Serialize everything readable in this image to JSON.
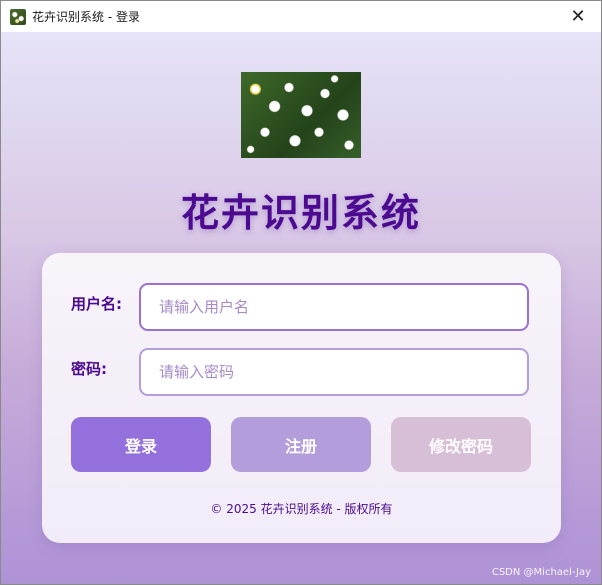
{
  "window": {
    "title": "花卉识别系统 - 登录",
    "close_glyph": "✕",
    "icon": "flower-photo-icon"
  },
  "header": {
    "app_title": "花卉识别系统"
  },
  "form": {
    "username_label": "用户名:",
    "username_placeholder": "请输入用户名",
    "password_label": "密码:",
    "password_placeholder": "请输入密码"
  },
  "buttons": {
    "login": "登录",
    "register": "注册",
    "change_password": "修改密码"
  },
  "footer": {
    "copyright": "© 2025 花卉识别系统 - 版权所有"
  },
  "watermark": "CSDN @Michael-Jay",
  "colors": {
    "title": "#4b0a8f",
    "login_button": "#9370db",
    "register_button": "#b39ddb",
    "change_password_button": "#d8bfd8"
  }
}
